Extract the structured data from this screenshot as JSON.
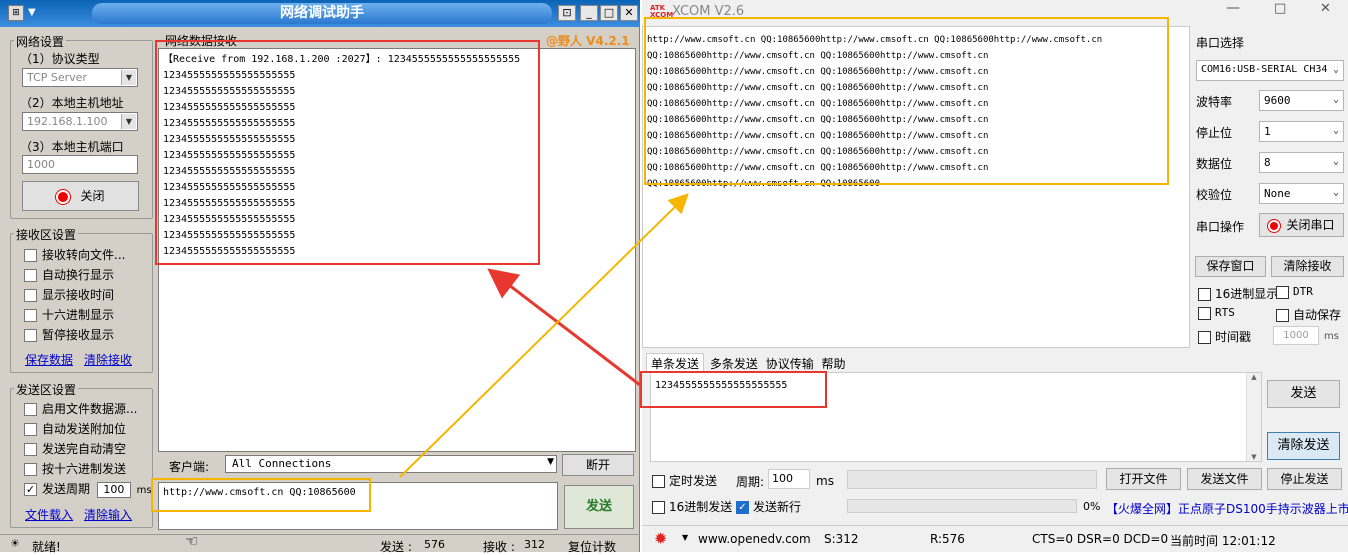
{
  "left": {
    "title": "网络调试助手",
    "version": "@野人 V4.2.1",
    "net_settings": {
      "label": "网络设置",
      "protocol_label": "（1）协议类型",
      "protocol_value": "TCP Server",
      "host_label": "（2）本地主机地址",
      "host_value": "192.168.1.100",
      "port_label": "（3）本地主机端口",
      "port_value": "1000",
      "close_button": "关闭"
    },
    "recv_settings": {
      "label": "接收区设置",
      "options": [
        "接收转向文件...",
        "自动换行显示",
        "显示接收时间",
        "十六进制显示",
        "暂停接收显示"
      ],
      "save_link": "保存数据",
      "clear_link": "清除接收"
    },
    "send_settings": {
      "label": "发送区设置",
      "options": [
        "启用文件数据源...",
        "自动发送附加位",
        "发送完自动清空",
        "按十六进制发送"
      ],
      "period_label": "发送周期",
      "period_value": "100",
      "period_unit": "ms",
      "load_link": "文件载入",
      "clear_link": "清除输入"
    },
    "recv_area": {
      "label": "网络数据接收",
      "first_line": "【Receive from 192.168.1.200 :2027】: 1234555555555555555555",
      "lines": [
        "1234555555555555555555",
        "1234555555555555555555",
        "1234555555555555555555",
        "1234555555555555555555",
        "1234555555555555555555",
        "1234555555555555555555",
        "1234555555555555555555",
        "1234555555555555555555",
        "1234555555555555555555",
        "1234555555555555555555",
        "1234555555555555555555",
        "1234555555555555555555"
      ]
    },
    "client_label": "客户端:",
    "client_value": "All Connections",
    "disconnect_button": "断开",
    "send_input": "http://www.cmsoft.cn QQ:10865600",
    "send_button": "发送",
    "status": {
      "ready": "就绪!",
      "send_label": "发送 :",
      "send_count": "576",
      "recv_label": "接收 :",
      "recv_count": "312",
      "reset_button": "复位计数"
    }
  },
  "right": {
    "title": "XCOM V2.6",
    "recv_lines": [
      "http://www.cmsoft.cn QQ:10865600http://www.cmsoft.cn QQ:10865600http://www.cmsoft.cn",
      "QQ:10865600http://www.cmsoft.cn QQ:10865600http://www.cmsoft.cn",
      "QQ:10865600http://www.cmsoft.cn QQ:10865600http://www.cmsoft.cn",
      "QQ:10865600http://www.cmsoft.cn QQ:10865600http://www.cmsoft.cn",
      "QQ:10865600http://www.cmsoft.cn QQ:10865600http://www.cmsoft.cn",
      "QQ:10865600http://www.cmsoft.cn QQ:10865600http://www.cmsoft.cn",
      "QQ:10865600http://www.cmsoft.cn QQ:10865600http://www.cmsoft.cn",
      "QQ:10865600http://www.cmsoft.cn QQ:10865600http://www.cmsoft.cn",
      "QQ:10865600http://www.cmsoft.cn QQ:10865600http://www.cmsoft.cn",
      "QQ:10865600http://www.cmsoft.cn QQ:10865600"
    ],
    "port_select_label": "串口选择",
    "port_value": "COM16:USB-SERIAL CH34",
    "baud_label": "波特率",
    "baud_value": "9600",
    "stop_label": "停止位",
    "stop_value": "1",
    "data_label": "数据位",
    "data_value": "8",
    "parity_label": "校验位",
    "parity_value": "None",
    "op_label": "串口操作",
    "close_port_button": "关闭串口",
    "save_window_button": "保存窗口",
    "clear_recv_button": "清除接收",
    "hex_display": "16进制显示",
    "dtr": "DTR",
    "rts": "RTS",
    "auto_save": "自动保存",
    "timestamp": "时间戳",
    "timestamp_value": "1000",
    "timestamp_unit": "ms",
    "tabs": [
      "单条发送",
      "多条发送",
      "协议传输",
      "帮助"
    ],
    "send_text": "1234555555555555555555",
    "send_button": "发送",
    "clear_send_button": "清除发送",
    "timed_send": "定时发送",
    "period_label": "周期:",
    "period_value": "100",
    "period_unit": "ms",
    "open_file_button": "打开文件",
    "send_file_button": "发送文件",
    "stop_send_button": "停止发送",
    "hex_send": "16进制发送",
    "send_newline": "发送新行",
    "progress_text": "0%",
    "ad_text": "【火爆全网】正点原子DS100手持示波器上市",
    "status": {
      "url": "www.openedv.com",
      "s": "S:312",
      "r": "R:576",
      "lines": "CTS=0 DSR=0 DCD=0",
      "time": "当前时间 12:01:12"
    },
    "colors": {
      "accent_red": "#e8372e",
      "accent_yellow": "#f5b500",
      "link_blue": "#0000cc"
    }
  }
}
